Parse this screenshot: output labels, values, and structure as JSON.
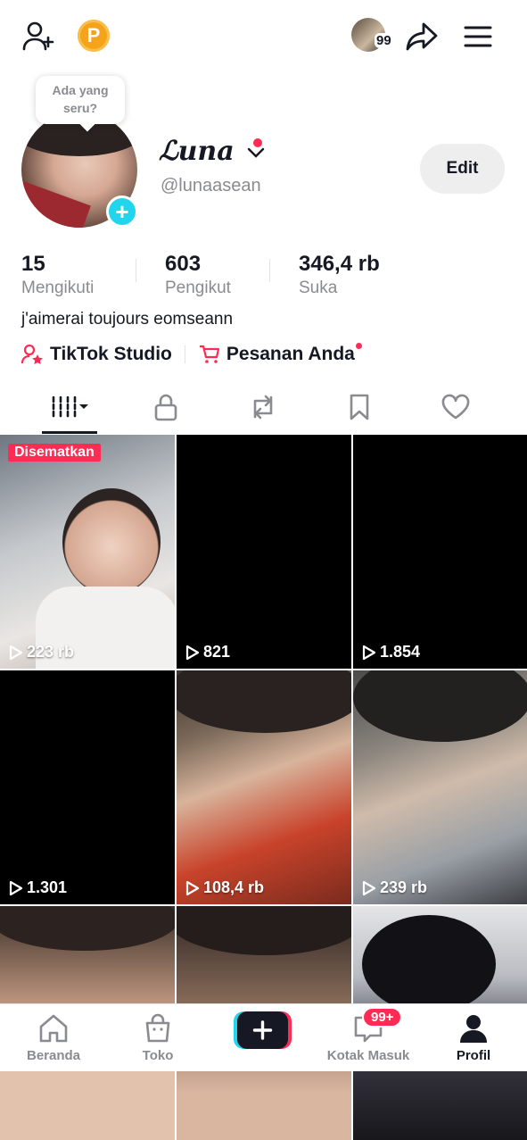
{
  "topbar": {
    "coin_letter": "P",
    "notification_count": "99"
  },
  "tooltip": {
    "text": "Ada yang seru?"
  },
  "profile": {
    "name": "ℒuna",
    "handle": "@lunaasean",
    "edit_label": "Edit"
  },
  "stats": [
    {
      "value": "15",
      "label": "Mengikuti"
    },
    {
      "value": "603",
      "label": "Pengikut"
    },
    {
      "value": "346,4 rb",
      "label": "Suka"
    }
  ],
  "bio": "j'aimerai toujours eomseann",
  "links": {
    "studio": "TikTok Studio",
    "orders": "Pesanan Anda"
  },
  "grid": {
    "pinned_label": "Disematkan",
    "videos": [
      {
        "views": "223 rb"
      },
      {
        "views": "821"
      },
      {
        "views": "1.854"
      },
      {
        "views": "1.301"
      },
      {
        "views": "108,4 rb"
      },
      {
        "views": "239 rb"
      },
      {
        "views": ""
      },
      {
        "views": ""
      },
      {
        "views": ""
      }
    ]
  },
  "bottomnav": {
    "home": "Beranda",
    "shop": "Toko",
    "inbox": "Kotak Masuk",
    "inbox_badge": "99+",
    "profile": "Profil"
  },
  "colors": {
    "accent": "#fe2c55",
    "cyan": "#20d5ec",
    "muted": "#8a8b91"
  }
}
